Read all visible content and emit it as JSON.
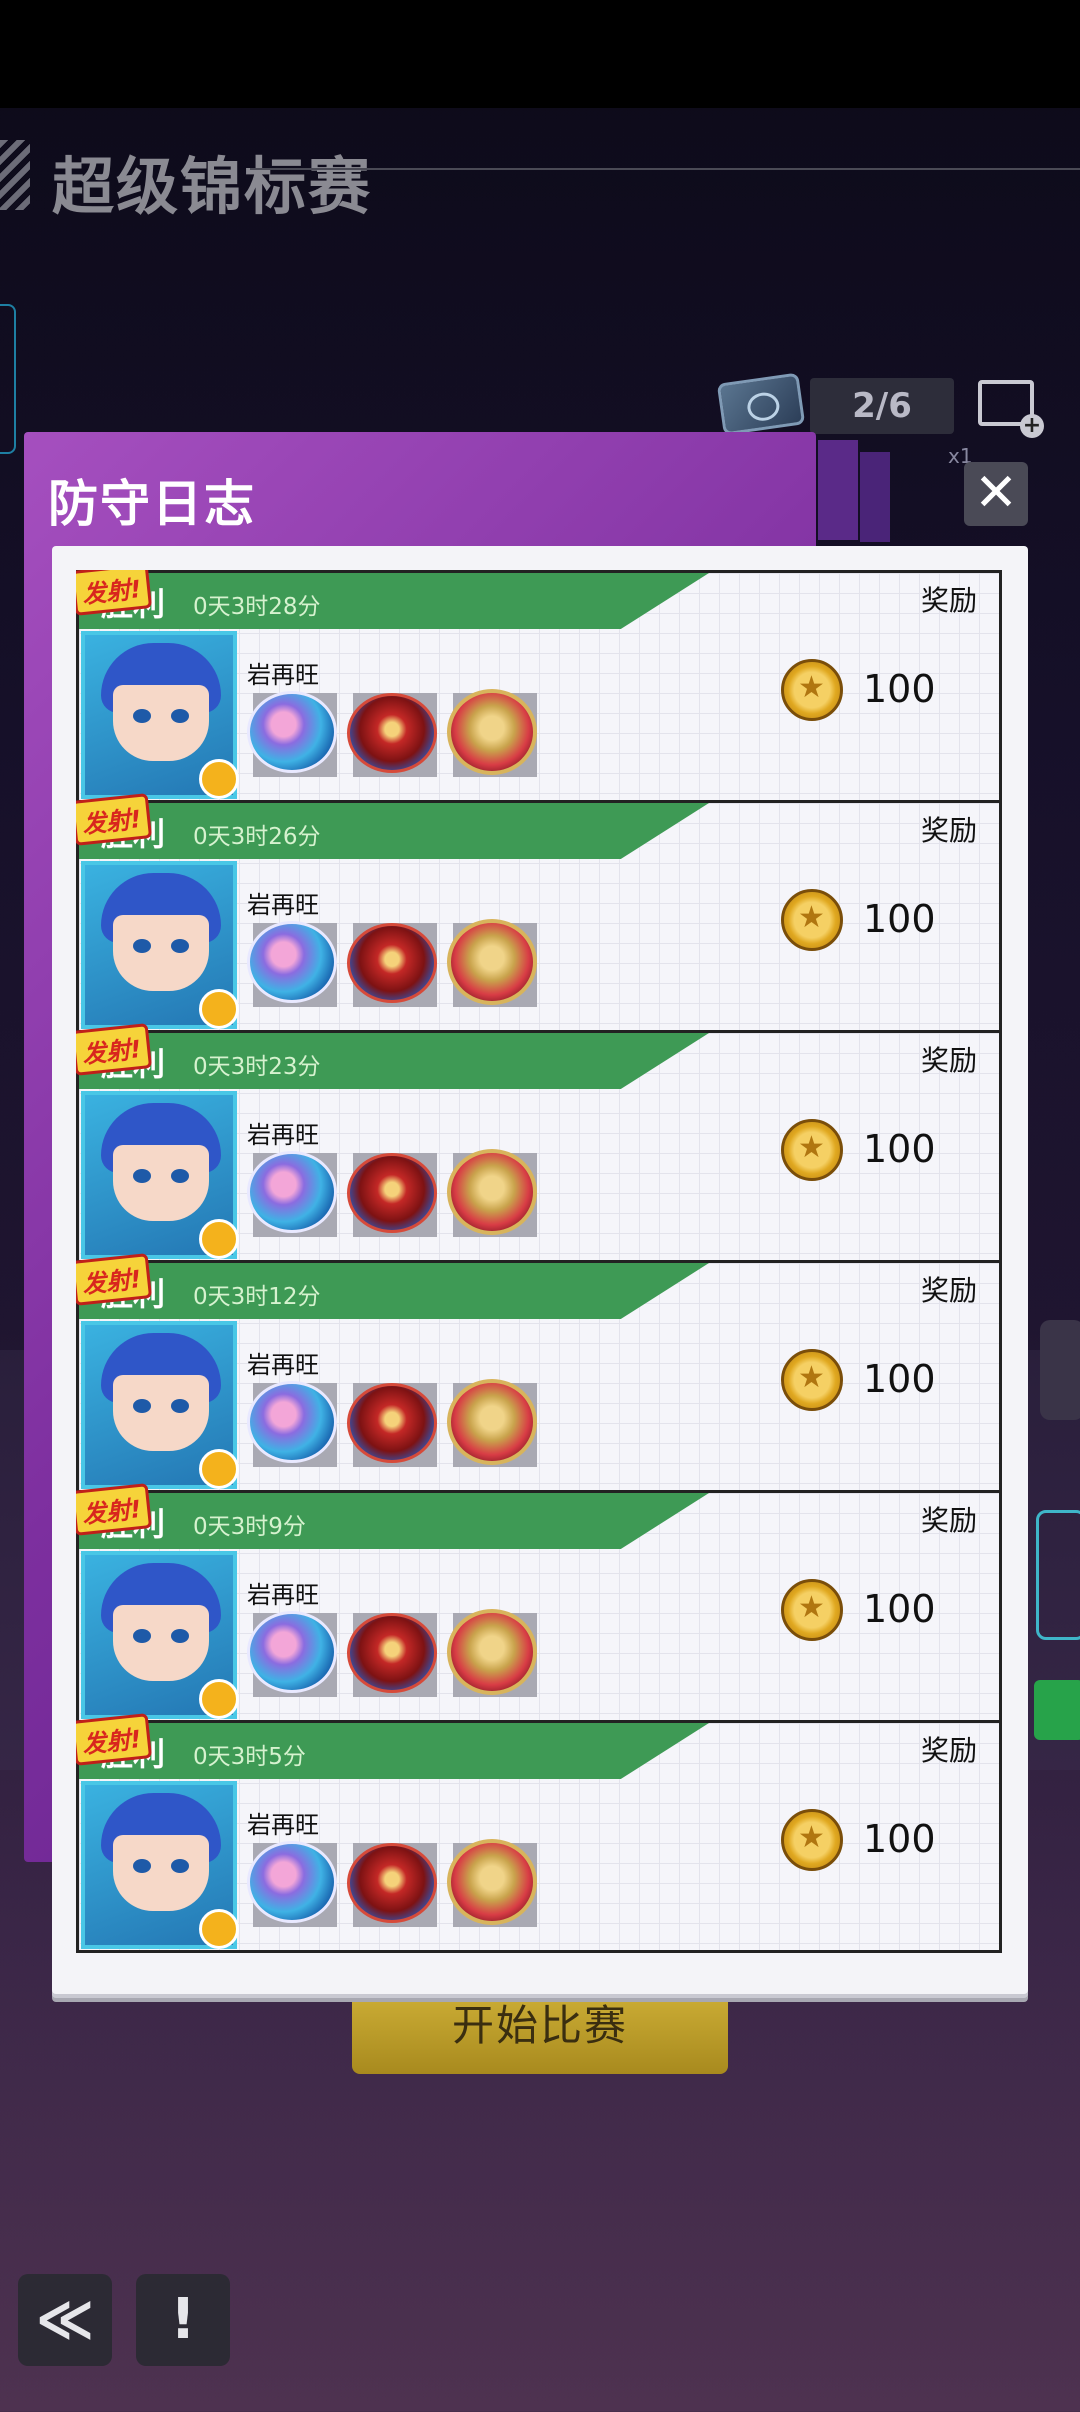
{
  "background": {
    "title": "超级锦标赛",
    "counter": "2/6",
    "ticket_multiplier": "x1",
    "start_button": "开始比赛",
    "back_icon": "≪",
    "info_icon": "!"
  },
  "dialog": {
    "title": "防守日志",
    "close_icon": "✕",
    "entries": [
      {
        "result": "胜利",
        "time": "0天3时28分",
        "reward_label": "奖励",
        "player": "岩再旺",
        "fire_tag": "发射!",
        "reward": "100"
      },
      {
        "result": "胜利",
        "time": "0天3时26分",
        "reward_label": "奖励",
        "player": "岩再旺",
        "fire_tag": "发射!",
        "reward": "100"
      },
      {
        "result": "胜利",
        "time": "0天3时23分",
        "reward_label": "奖励",
        "player": "岩再旺",
        "fire_tag": "发射!",
        "reward": "100"
      },
      {
        "result": "胜利",
        "time": "0天3时12分",
        "reward_label": "奖励",
        "player": "岩再旺",
        "fire_tag": "发射!",
        "reward": "100"
      },
      {
        "result": "胜利",
        "time": "0天3时9分",
        "reward_label": "奖励",
        "player": "岩再旺",
        "fire_tag": "发射!",
        "reward": "100"
      },
      {
        "result": "胜利",
        "time": "0天3时5分",
        "reward_label": "奖励",
        "player": "岩再旺",
        "fire_tag": "发射!",
        "reward": "100"
      }
    ]
  },
  "colors": {
    "ribbon": "#3e9a55",
    "dialog_header": "#7d2f9f",
    "start_button": "#c2a230"
  }
}
